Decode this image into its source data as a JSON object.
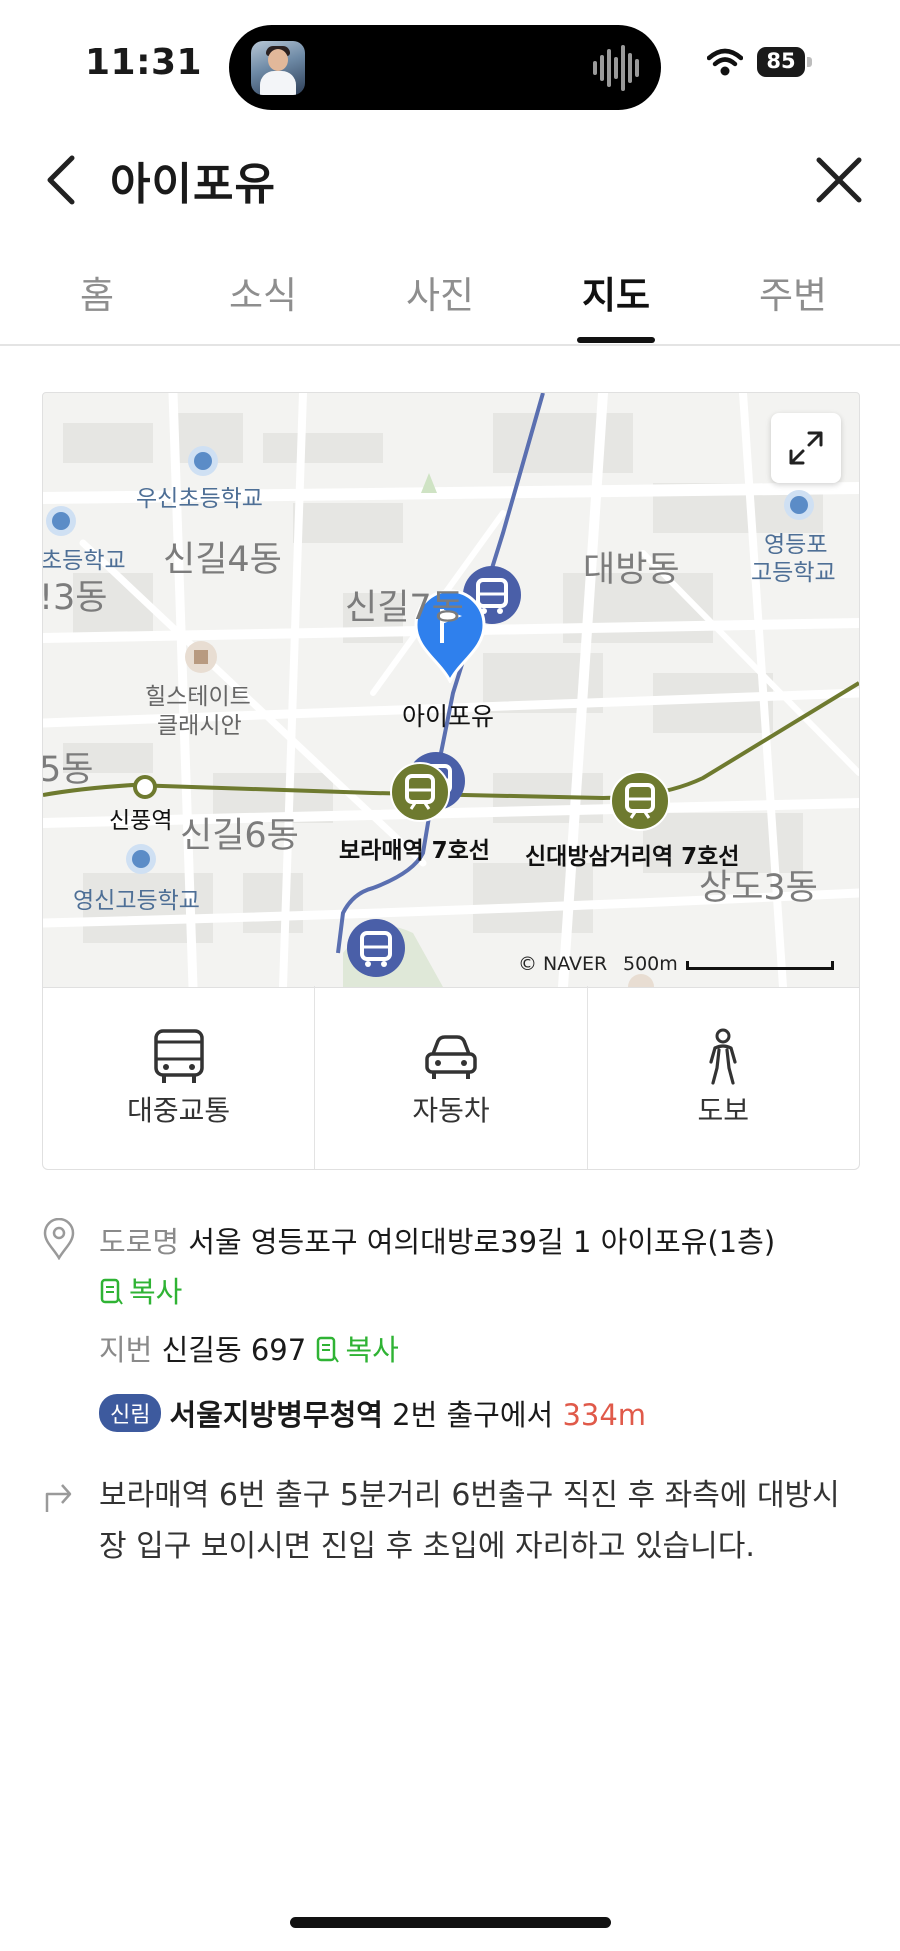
{
  "status_bar": {
    "time": "11:31",
    "battery": "85"
  },
  "header": {
    "title": "아이포유"
  },
  "tabs": [
    {
      "label": "홈",
      "active": false
    },
    {
      "label": "소식",
      "active": false
    },
    {
      "label": "사진",
      "active": false
    },
    {
      "label": "지도",
      "active": true
    },
    {
      "label": "주변",
      "active": false
    }
  ],
  "map": {
    "place_label": "아이포유",
    "dongs": [
      "신길4동",
      "대방동",
      "신길7동",
      "신길6동",
      "상도3동",
      "!3동",
      "5동"
    ],
    "schools": [
      "우신초등학교",
      "초등학교",
      "영등포",
      "고등학교",
      "영신고등학교"
    ],
    "apartment": [
      "힐스테이트",
      "클래시안"
    ],
    "stations": [
      "신풍역",
      "보라매역 7호선",
      "신대방삼거리역 7호선"
    ],
    "credit": "© NAVER",
    "scale": "500m",
    "colors": {
      "line7": "#6e7a2f",
      "bus": "#4a5fa8",
      "place_pin": "#2f80ed"
    }
  },
  "transport": [
    {
      "label": "대중교통",
      "icon": "bus-icon"
    },
    {
      "label": "자동차",
      "icon": "car-icon"
    },
    {
      "label": "도보",
      "icon": "walk-icon"
    }
  ],
  "address": {
    "road_label": "도로명",
    "road": "서울 영등포구 여의대방로39길 1 아이포유(1층)",
    "copy": "복사",
    "jibun_label": "지번",
    "jibun": "신길동 697",
    "line_badge": "신림",
    "station": "서울지방병무청역",
    "exit_text": "2번 출구에서",
    "distance": "334m"
  },
  "directions": "보라매역 6번 출구 5분거리 6번출구 직진 후 좌측에 대방시장 입구 보이시면 진입 후 초입에 자리하고 있습니다."
}
